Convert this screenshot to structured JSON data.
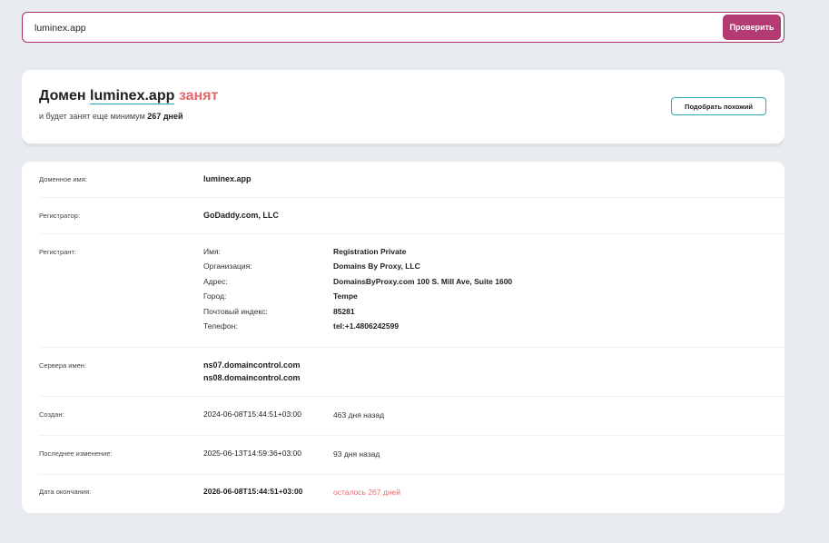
{
  "search": {
    "value": "luminex.app",
    "button_label": "Проверить"
  },
  "status": {
    "prefix": "Домен",
    "domain": "luminex.app",
    "state": "занят",
    "sub_prefix": "и будет занят еще минимум",
    "sub_days": "267 дней",
    "similar_button": "Подобрать похожий"
  },
  "info": {
    "domain": {
      "label": "Доменное имя:",
      "value": "luminex.app"
    },
    "registrar": {
      "label": "Регистратор:",
      "value": "GoDaddy.com, LLC"
    },
    "registrant": {
      "label": "Регистрант:",
      "fields": [
        {
          "label": "Имя:",
          "value": "Registration Private"
        },
        {
          "label": "Организация:",
          "value": "Domains By Proxy, LLC"
        },
        {
          "label": "Адрес:",
          "value": "DomainsByProxy.com 100 S. Mill Ave, Suite 1600"
        },
        {
          "label": "Город:",
          "value": "Tempe"
        },
        {
          "label": "Почтовый индекс:",
          "value": "85281"
        },
        {
          "label": "Телефон:",
          "value": "tel:+1.4806242599"
        }
      ]
    },
    "nameservers": {
      "label": "Сервера имен:",
      "values": [
        "ns07.domaincontrol.com",
        "ns08.domaincontrol.com"
      ]
    },
    "created": {
      "label": "Создан:",
      "value": "2024-06-08T15:44:51+03:00",
      "ago": "463 дня назад"
    },
    "updated": {
      "label": "Последнее изменение:",
      "value": "2025-06-13T14:59:36+03:00",
      "ago": "93 дня назад"
    },
    "expires": {
      "label": "Дата окончания:",
      "value": "2026-06-08T15:44:51+03:00",
      "ago": "осталось 267 дней"
    }
  },
  "colors": {
    "accent": "#b43b72",
    "busy": "#e8676b",
    "outline": "#2aa8c4",
    "background": "#e8ecf0"
  }
}
